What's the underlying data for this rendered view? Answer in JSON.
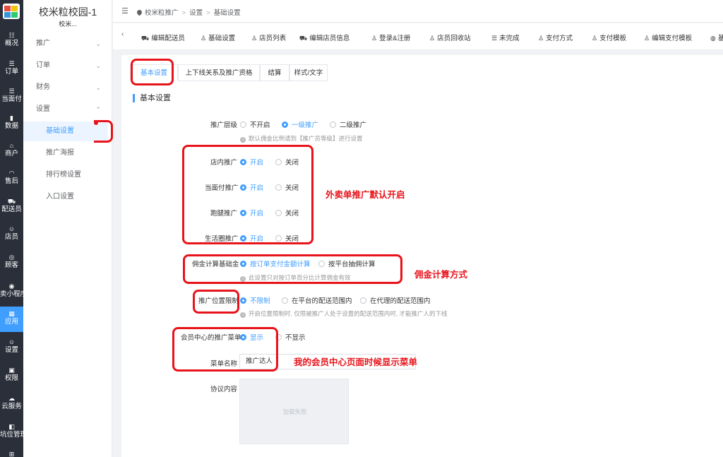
{
  "rail": {
    "items": [
      {
        "icon": "overview-icon",
        "glyph": "☷",
        "label": "概况"
      },
      {
        "icon": "order-icon",
        "glyph": "☰",
        "label": "订单"
      },
      {
        "icon": "facepay-icon",
        "glyph": "☰",
        "label": "当面付"
      },
      {
        "icon": "data-icon",
        "glyph": "▮",
        "label": "数据"
      },
      {
        "icon": "shop-icon",
        "glyph": "⌂",
        "label": "商户"
      },
      {
        "icon": "aftersale-icon",
        "glyph": "◠",
        "label": "售后"
      },
      {
        "icon": "courier-icon",
        "glyph": "⛟",
        "label": "配送员"
      },
      {
        "icon": "clerk-icon",
        "glyph": "☺",
        "label": "店员"
      },
      {
        "icon": "customer-icon",
        "glyph": "◎",
        "label": "顾客"
      },
      {
        "icon": "miniapp-icon",
        "glyph": "◉",
        "label": "卖小程序"
      },
      {
        "icon": "apps-icon",
        "glyph": "▦",
        "label": "应用"
      },
      {
        "icon": "settings-icon",
        "glyph": "☺",
        "label": "设置"
      },
      {
        "icon": "permission-icon",
        "glyph": "▣",
        "label": "权限"
      },
      {
        "icon": "cloud-icon",
        "glyph": "☁",
        "label": "云服务"
      },
      {
        "icon": "slot-icon",
        "glyph": "◧",
        "label": "坑位管理"
      },
      {
        "icon": "windows-icon",
        "glyph": "⊞",
        "label": ""
      }
    ]
  },
  "sidebar": {
    "title": "校米粒校园-1",
    "subtitle": "校米...",
    "groups": [
      {
        "label": "推广",
        "chevron": "⌄"
      },
      {
        "label": "订单",
        "chevron": "⌄"
      },
      {
        "label": "财务",
        "chevron": "⌄"
      },
      {
        "label": "设置",
        "chevron": "⌃"
      }
    ],
    "items": [
      {
        "label": "基础设置"
      },
      {
        "label": "推广海报"
      },
      {
        "label": "排行榜设置"
      },
      {
        "label": "入口设置"
      }
    ]
  },
  "header": {
    "fold_glyph": "☰",
    "breadcrumb": [
      "校米粒推广",
      "设置",
      "基础设置"
    ],
    "sep": ">"
  },
  "tabs": {
    "prev_glyph": "‹",
    "items": [
      {
        "icon": "truck-icon",
        "glyph": "⛟",
        "label": "编辑配送员"
      },
      {
        "icon": "person-icon",
        "glyph": "♙",
        "label": "基础设置"
      },
      {
        "icon": "person-icon",
        "glyph": "♙",
        "label": "店员列表"
      },
      {
        "icon": "truck-icon",
        "glyph": "⛟",
        "label": "编辑店员信息"
      },
      {
        "icon": "person-icon",
        "glyph": "♙",
        "label": "登录&注册"
      },
      {
        "icon": "person-icon",
        "glyph": "♙",
        "label": "店员回收站"
      },
      {
        "icon": "list-icon",
        "glyph": "☰",
        "label": "未完成"
      },
      {
        "icon": "person-icon",
        "glyph": "♙",
        "label": "支付方式"
      },
      {
        "icon": "person-icon",
        "glyph": "♙",
        "label": "支付模板"
      },
      {
        "icon": "person-icon",
        "glyph": "♙",
        "label": "编辑支付模板"
      },
      {
        "icon": "chat-icon",
        "glyph": "◍",
        "label": "基"
      }
    ]
  },
  "subtabs": [
    "基本设置",
    "上下线关系及推广资格",
    "结算",
    "样式/文字"
  ],
  "section_title": "基本设置",
  "form": {
    "level": {
      "label": "推广层级",
      "options": [
        "不开启",
        "一级推广",
        "二级推广"
      ],
      "hint": "默认佣金比例请到【推广员等级】进行设置"
    },
    "store": {
      "label": "店内推广",
      "options": [
        "开启",
        "关闭"
      ]
    },
    "facepay": {
      "label": "当面付推广",
      "options": [
        "开启",
        "关闭"
      ]
    },
    "errand": {
      "label": "跑腿推广",
      "options": [
        "开启",
        "关闭"
      ]
    },
    "life": {
      "label": "生活圈推广",
      "options": [
        "开启",
        "关闭"
      ]
    },
    "commission": {
      "label": "佣金计算基础金",
      "options": [
        "按订单支付金额计算",
        "按平台抽佣计算"
      ],
      "hint": "此设置只对按订单百分比计算佣金有效"
    },
    "position": {
      "label": "推广位置限制",
      "options": [
        "不限制",
        "在平台的配送范围内",
        "在代理的配送范围内"
      ],
      "hint": "开启位置限制时, 仅限被推广人处于设置的配送范围内时, 才能推广人的下线"
    },
    "member_menu": {
      "label": "会员中心的推广菜单",
      "options": [
        "显示",
        "不显示"
      ]
    },
    "menu_name": {
      "label": "菜单名称",
      "value": "推广达人"
    },
    "agreement": {
      "label": "协议内容",
      "image_text": "加载失败"
    }
  },
  "annotations": {
    "note1": "外卖单推广默认开启",
    "note2": "佣金计算方式",
    "note3": "我的会员中心页面时候显示菜单"
  },
  "colors": {
    "accent": "#409eff",
    "annotation_red": "#e8141b",
    "rail_bg": "#2b2f3a"
  }
}
